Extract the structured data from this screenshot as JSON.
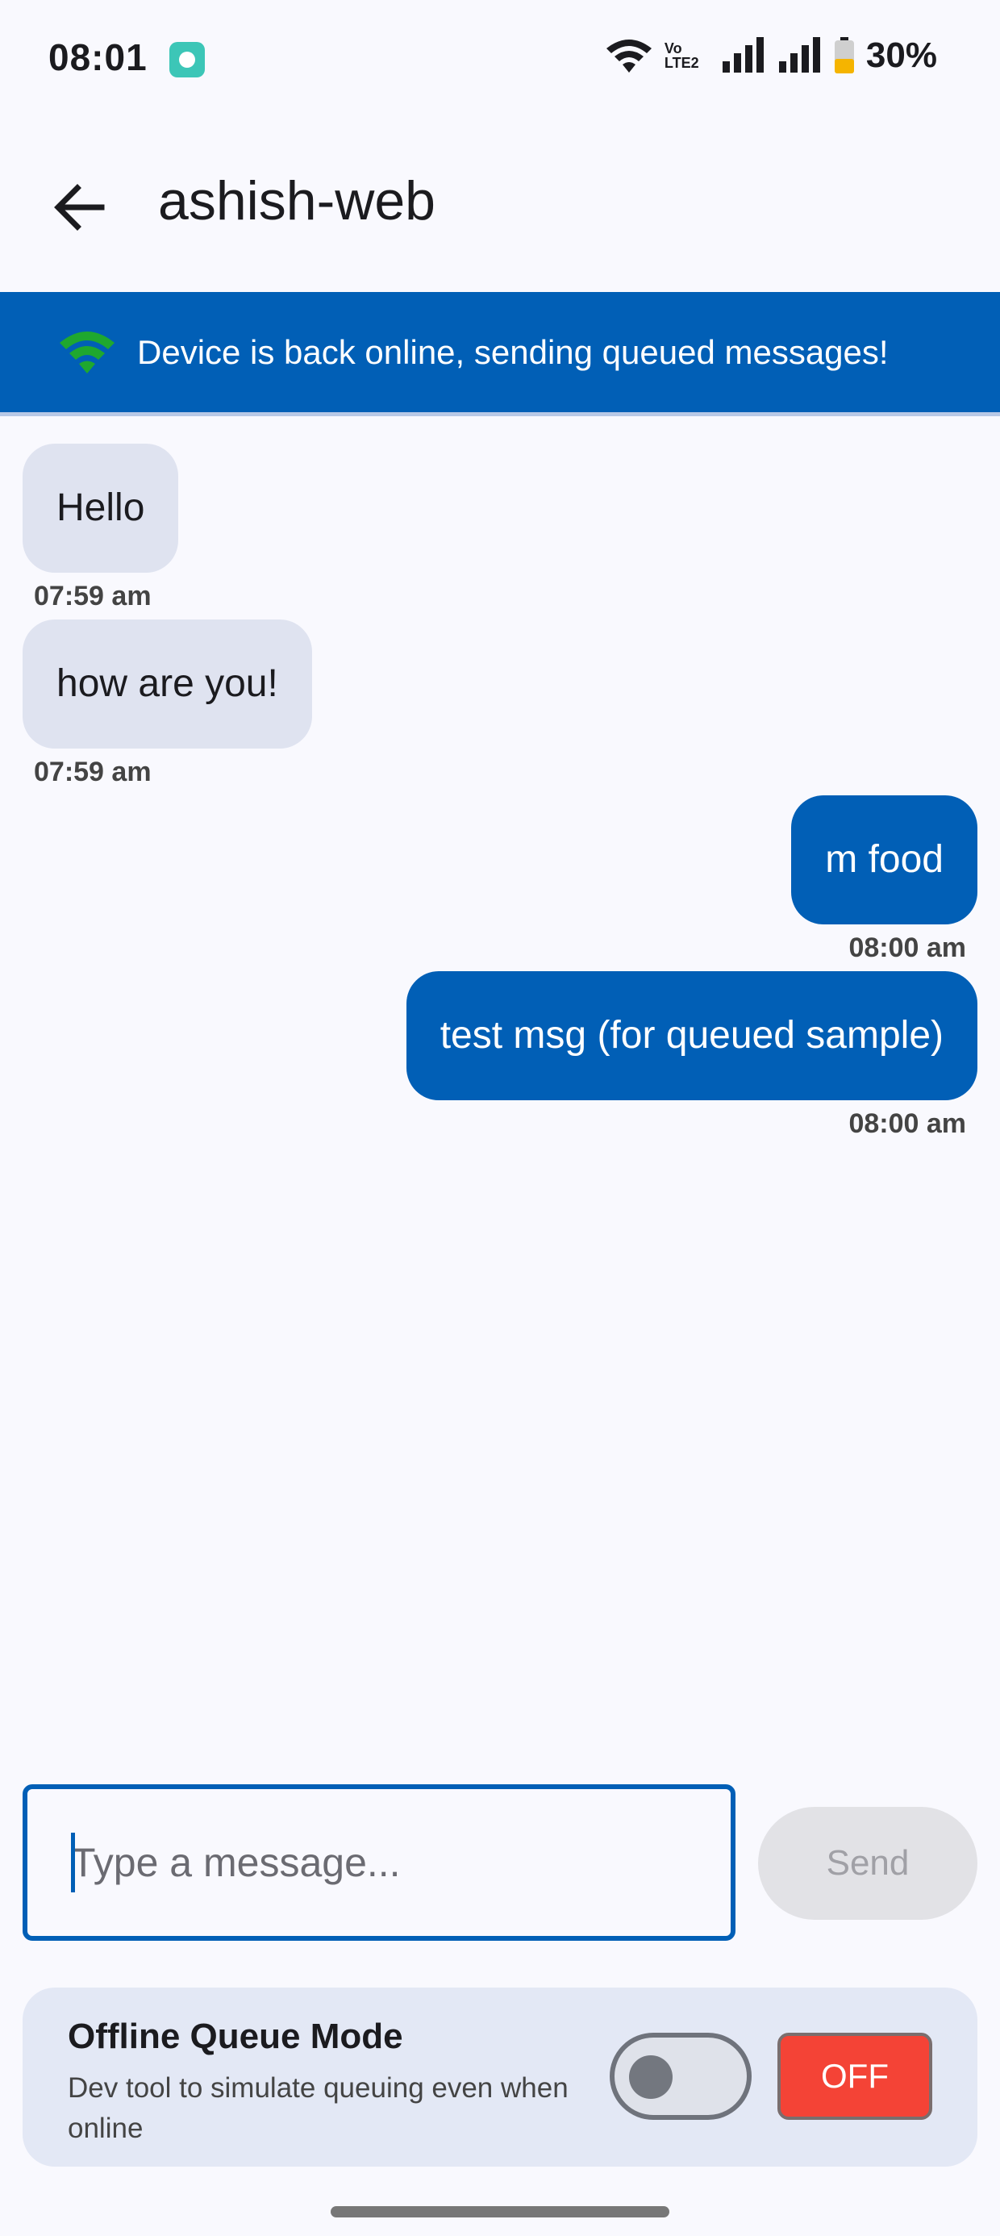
{
  "status_bar": {
    "time": "08:01",
    "network_label": "Vo LTE2",
    "battery": "30%"
  },
  "header": {
    "title": "ashish-web",
    "back_icon": "arrow-left-icon"
  },
  "banner": {
    "icon": "wifi-icon",
    "text": "Device is back online, sending queued messages!",
    "color": "#015fb6",
    "icon_color": "#1fa82f"
  },
  "messages": [
    {
      "text": "Hello",
      "time": "07:59 am",
      "direction": "received"
    },
    {
      "text": "how are you!",
      "time": "07:59 am",
      "direction": "received"
    },
    {
      "text": "m food",
      "time": "08:00 am",
      "direction": "sent"
    },
    {
      "text": "test msg (for queued sample)",
      "time": "08:00 am",
      "direction": "sent"
    }
  ],
  "composer": {
    "placeholder": "Type a message...",
    "value": "",
    "send_label": "Send"
  },
  "dev_tool": {
    "title": "Offline Queue Mode",
    "description": "Dev tool to simulate queuing even when online",
    "toggle_on": false,
    "state_label": "OFF",
    "state_color": "#f44336"
  }
}
